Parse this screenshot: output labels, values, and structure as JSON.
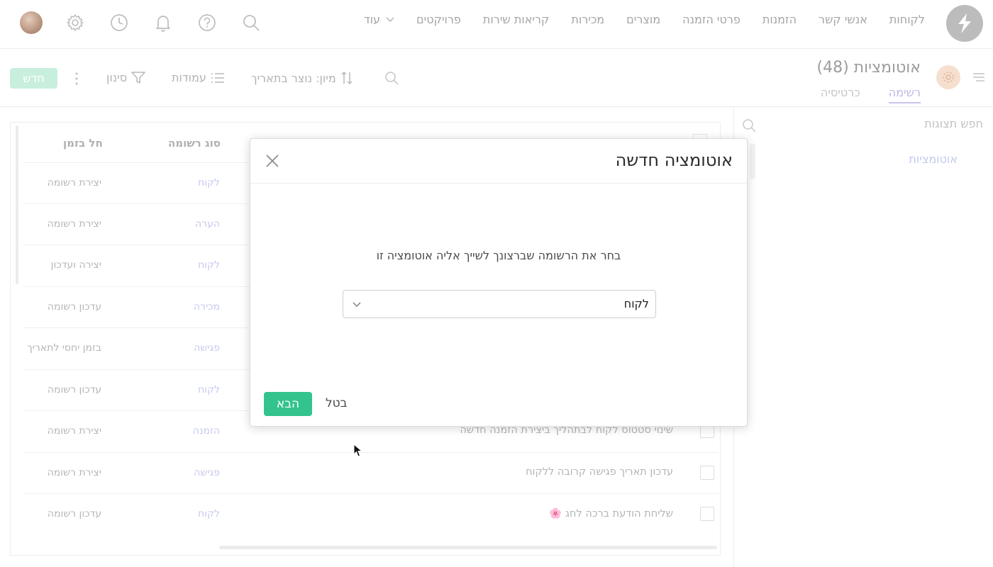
{
  "nav": {
    "items": [
      "לקוחות",
      "אנשי קשר",
      "הזמנות",
      "פרטי הזמנה",
      "מוצרים",
      "מכירות",
      "קריאות שירות",
      "פרויקטים"
    ],
    "more_label": "עוד"
  },
  "header": {
    "title": "אוטומציות (48)",
    "tabs": [
      {
        "label": "רשימה",
        "active": true
      },
      {
        "label": "כרטיסיה",
        "active": false
      }
    ]
  },
  "toolbar": {
    "sort_label": "מיון: נוצר בתאריך",
    "columns_label": "עמודות",
    "filter_label": "סינון",
    "new_label": "חדש"
  },
  "side_panel": {
    "search_placeholder": "חפש תצוגות",
    "items": [
      "אוטומציות"
    ]
  },
  "table": {
    "headers": {
      "record_type": "סוג רשומה",
      "trigger": "חל בזמן"
    },
    "rows": [
      {
        "name": "",
        "record_type": "לקוח",
        "trigger": "יצירת רשומה"
      },
      {
        "name": "",
        "record_type": "הערה",
        "trigger": "יצירת רשומה"
      },
      {
        "name": "",
        "record_type": "לקוח",
        "trigger": "יצירה ועדכון"
      },
      {
        "name": "",
        "record_type": "מכירה",
        "trigger": "עדכון רשומה"
      },
      {
        "name": "",
        "record_type": "פגישה",
        "trigger": "בזמן יחסי לתאריך"
      },
      {
        "name": "",
        "record_type": "לקוח",
        "trigger": "עדכון רשומה"
      },
      {
        "name": "שינוי סטטוס לקוח לבתהליך ביצירת הזמנה חדשה",
        "record_type": "הזמנה",
        "trigger": "יצירת רשומה"
      },
      {
        "name": "עדכון תאריך פגישה קרובה ללקוח",
        "record_type": "פגישה",
        "trigger": "יצירת רשומה"
      },
      {
        "name": "שליחת הודעת ברכה לחג 🌸",
        "record_type": "לקוח",
        "trigger": "עדכון רשומה"
      }
    ]
  },
  "modal": {
    "title": "אוטומציה חדשה",
    "prompt": "בחר את הרשומה שברצונך לשייך אליה אוטומציה זו",
    "select_value": "לקוח",
    "next_label": "הבא",
    "cancel_label": "בטל"
  },
  "colors": {
    "accent_green": "#33c38d",
    "accent_purple": "#c6c9ef"
  },
  "icons": [
    "logo-icon",
    "search-icon",
    "help-icon",
    "bell-icon",
    "clock-icon",
    "gear-icon",
    "chevron-down-icon",
    "sort-icon",
    "columns-icon",
    "filter-icon",
    "kebab-icon",
    "close-icon",
    "hamburger-icon"
  ]
}
